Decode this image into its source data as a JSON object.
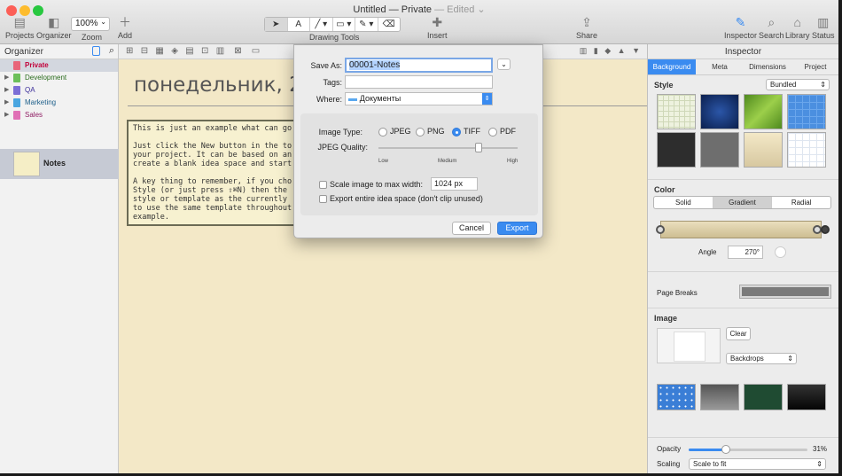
{
  "window": {
    "title": "Untitled — Private",
    "edited": "— Edited ⌄"
  },
  "toolbar": {
    "projects": "Projects",
    "organizer": "Organizer",
    "zoom_value": "100%",
    "zoom": "Zoom",
    "add": "Add",
    "drawing_tools": "Drawing Tools",
    "insert": "Insert",
    "share": "Share",
    "inspector": "Inspector",
    "search": "Search",
    "library": "Library",
    "status": "Status"
  },
  "sidebar": {
    "title": "Organizer",
    "items": [
      {
        "label": "Private",
        "color": "#e8657a"
      },
      {
        "label": "Development",
        "color": "#6bbf5a"
      },
      {
        "label": "QA",
        "color": "#7c6fd6"
      },
      {
        "label": "Marketing",
        "color": "#4aa6e0"
      },
      {
        "label": "Sales",
        "color": "#e070b6"
      }
    ],
    "notes_label": "Notes"
  },
  "canvas": {
    "heading": "понедельник, 23",
    "note_text": "This is just an example what can go\n\nJust click the New button in the to\nyour project. It can be based on an\ncreate a blank idea space and start\n\nA key thing to remember, if you cho\nStyle (or just press ⇧⌘N) then the\nstyle or template as the currently \nto use the same template throughout\nexample."
  },
  "dialog": {
    "save_as_label": "Save As:",
    "save_as_value": "00001-Notes",
    "tags_label": "Tags:",
    "tags_value": "",
    "where_label": "Where:",
    "where_value": "Документы",
    "image_type_label": "Image Type:",
    "types": [
      "JPEG",
      "PNG",
      "TIFF",
      "PDF"
    ],
    "selected_type": "TIFF",
    "quality_label": "JPEG Quality:",
    "quality_low": "Low",
    "quality_medium": "Medium",
    "quality_high": "High",
    "quality_level": 0.72,
    "scale_label": "Scale image to max width:",
    "scale_value": "1024 px",
    "export_all_label": "Export entire idea space (don't clip unused)",
    "cancel": "Cancel",
    "export": "Export"
  },
  "inspector": {
    "title": "Inspector",
    "tabs": [
      "Background",
      "Meta",
      "Dimensions",
      "Project"
    ],
    "style_label": "Style",
    "style_popup": "Bundled",
    "color_label": "Color",
    "color_modes": [
      "Solid",
      "Gradient",
      "Radial"
    ],
    "angle_label": "Angle",
    "angle_value": "270°",
    "page_breaks_label": "Page Breaks",
    "image_label": "Image",
    "clear": "Clear",
    "backdrops": "Backdrops",
    "opacity_label": "Opacity",
    "opacity_value": "31%",
    "opacity_level": 0.31,
    "scaling_label": "Scaling",
    "scaling_value": "Scale to fit"
  }
}
